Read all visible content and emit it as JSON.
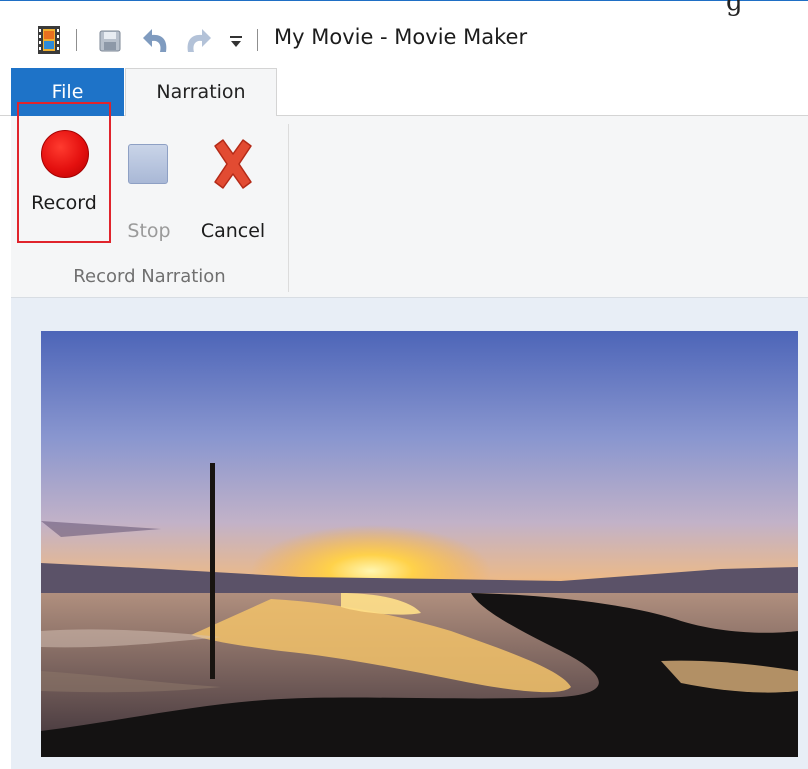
{
  "window": {
    "title": "My Movie - Movie Maker",
    "partial_glyph": "g"
  },
  "quick_access": {
    "icons": [
      "movie-maker-app-icon",
      "save-icon",
      "undo-icon",
      "redo-icon",
      "customize-dropdown-icon"
    ]
  },
  "tabs": {
    "file": "File",
    "narration": "Narration"
  },
  "ribbon": {
    "record": "Record",
    "stop": "Stop",
    "cancel": "Cancel",
    "group": "Record Narration"
  },
  "colors": {
    "file_tab": "#1e73c8",
    "record_icon": "#e4100f",
    "highlight_box": "#e0242c",
    "cancel_icon": "#e0442c"
  }
}
